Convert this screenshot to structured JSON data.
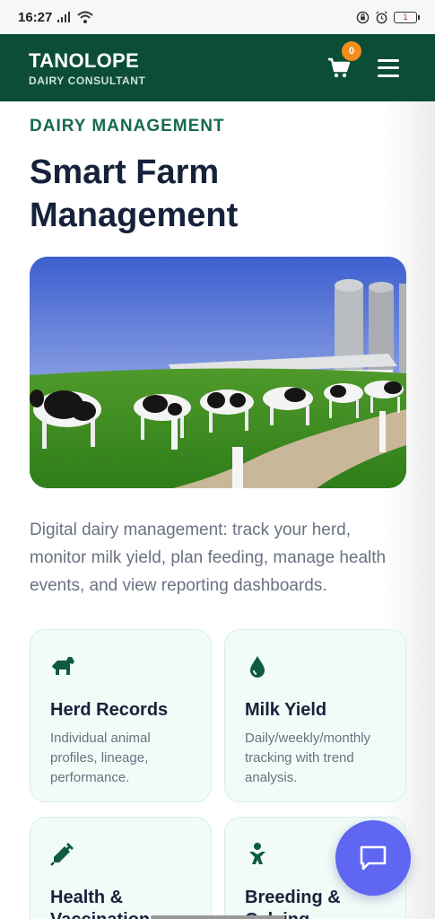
{
  "status_bar": {
    "time": "16:27",
    "battery": "1"
  },
  "header": {
    "brand_title": "TANOLOPE",
    "brand_subtitle": "DAIRY CONSULTANT",
    "cart_count": "0"
  },
  "main": {
    "eyebrow": "DAIRY MANAGEMENT",
    "title": "Smart Farm Management",
    "description": "Digital dairy management: track your herd, monitor milk yield, plan feeding, manage health events, and view reporting dashboards."
  },
  "features": [
    {
      "icon": "horse-icon",
      "title": "Herd Records",
      "text": "Individual animal profiles, lineage, performance."
    },
    {
      "icon": "droplet-icon",
      "title": "Milk Yield",
      "text": "Daily/weekly/monthly tracking with trend analysis."
    },
    {
      "icon": "syringe-icon",
      "title": "Health & Vaccination",
      "text": ""
    },
    {
      "icon": "baby-icon",
      "title": "Breeding & Calving",
      "text": ""
    }
  ],
  "colors": {
    "brand_green": "#0c4d37",
    "accent_green": "#166b4b",
    "badge_orange": "#f28c1b",
    "chat_purple": "#5f66f2"
  }
}
